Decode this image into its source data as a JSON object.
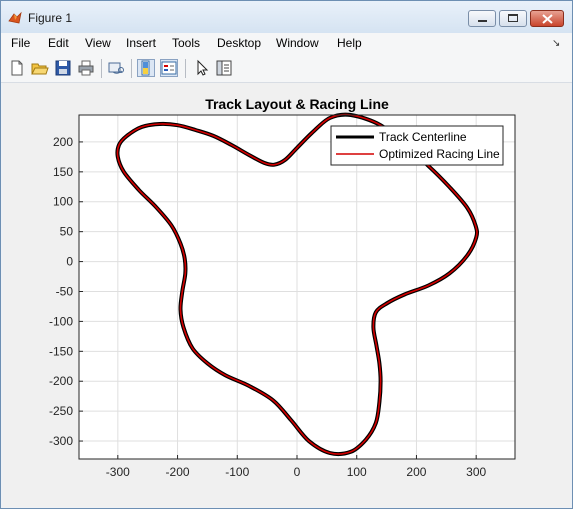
{
  "window": {
    "title": "Figure 1"
  },
  "menu": [
    "File",
    "Edit",
    "View",
    "Insert",
    "Tools",
    "Desktop",
    "Window",
    "Help"
  ],
  "toolbar_icons": [
    "new-figure-icon",
    "open-file-icon",
    "save-icon",
    "print-icon",
    "link-plot-icon",
    "insert-colorbar-icon",
    "insert-legend-icon",
    "edit-plot-arrow-icon",
    "property-inspector-icon"
  ],
  "chart_data": {
    "type": "line",
    "title": "Track Layout & Racing Line",
    "xlabel": "",
    "ylabel": "",
    "xlim": [
      -365,
      365
    ],
    "ylim": [
      -330,
      245
    ],
    "xticks": [
      -300,
      -200,
      -100,
      0,
      100,
      200,
      300
    ],
    "yticks": [
      200,
      150,
      100,
      50,
      0,
      -50,
      -100,
      -150,
      -200,
      -250,
      -300
    ],
    "grid": true,
    "legend_position": "top-right",
    "series": [
      {
        "name": "Track Centerline",
        "color": "#000000",
        "x": [
          90,
          140,
          180,
          220,
          255,
          285,
          299,
          300,
          285,
          255,
          220,
          180,
          150,
          132,
          128,
          133,
          138,
          140,
          138,
          132,
          115,
          90,
          55,
          20,
          -10,
          -40,
          -80,
          -120,
          -150,
          -175,
          -190,
          -195,
          -192,
          -187,
          -188,
          -195,
          -210,
          -235,
          -265,
          -290,
          -300,
          -298,
          -285,
          -260,
          -230,
          -200,
          -170,
          -140,
          -110,
          -80,
          -55,
          -38,
          -20,
          0,
          25,
          55,
          90
        ],
        "y": [
          245,
          228,
          195,
          160,
          125,
          90,
          60,
          40,
          10,
          -20,
          -40,
          -55,
          -70,
          -85,
          -110,
          -140,
          -170,
          -200,
          -235,
          -270,
          -298,
          -318,
          -320,
          -300,
          -265,
          -232,
          -208,
          -190,
          -170,
          -145,
          -110,
          -80,
          -50,
          -20,
          5,
          30,
          60,
          90,
          120,
          150,
          175,
          195,
          210,
          225,
          230,
          228,
          220,
          210,
          195,
          178,
          165,
          162,
          170,
          190,
          215,
          240,
          245
        ]
      },
      {
        "name": "Optimized Racing Line",
        "color": "#d40000",
        "x": [
          90,
          140,
          180,
          220,
          255,
          285,
          299,
          300,
          285,
          255,
          220,
          180,
          150,
          132,
          128,
          133,
          138,
          140,
          138,
          132,
          115,
          90,
          55,
          20,
          -10,
          -40,
          -80,
          -120,
          -150,
          -175,
          -190,
          -195,
          -192,
          -187,
          -188,
          -195,
          -210,
          -235,
          -265,
          -290,
          -300,
          -298,
          -285,
          -260,
          -230,
          -200,
          -170,
          -140,
          -110,
          -80,
          -55,
          -38,
          -20,
          0,
          25,
          55,
          90
        ],
        "y": [
          245,
          228,
          195,
          160,
          125,
          90,
          60,
          40,
          10,
          -20,
          -40,
          -55,
          -70,
          -85,
          -110,
          -140,
          -170,
          -200,
          -235,
          -270,
          -298,
          -318,
          -320,
          -300,
          -265,
          -232,
          -208,
          -190,
          -170,
          -145,
          -110,
          -80,
          -50,
          -20,
          5,
          30,
          60,
          90,
          120,
          150,
          175,
          195,
          210,
          225,
          230,
          228,
          220,
          210,
          195,
          178,
          165,
          162,
          170,
          190,
          215,
          240,
          245
        ]
      }
    ]
  }
}
